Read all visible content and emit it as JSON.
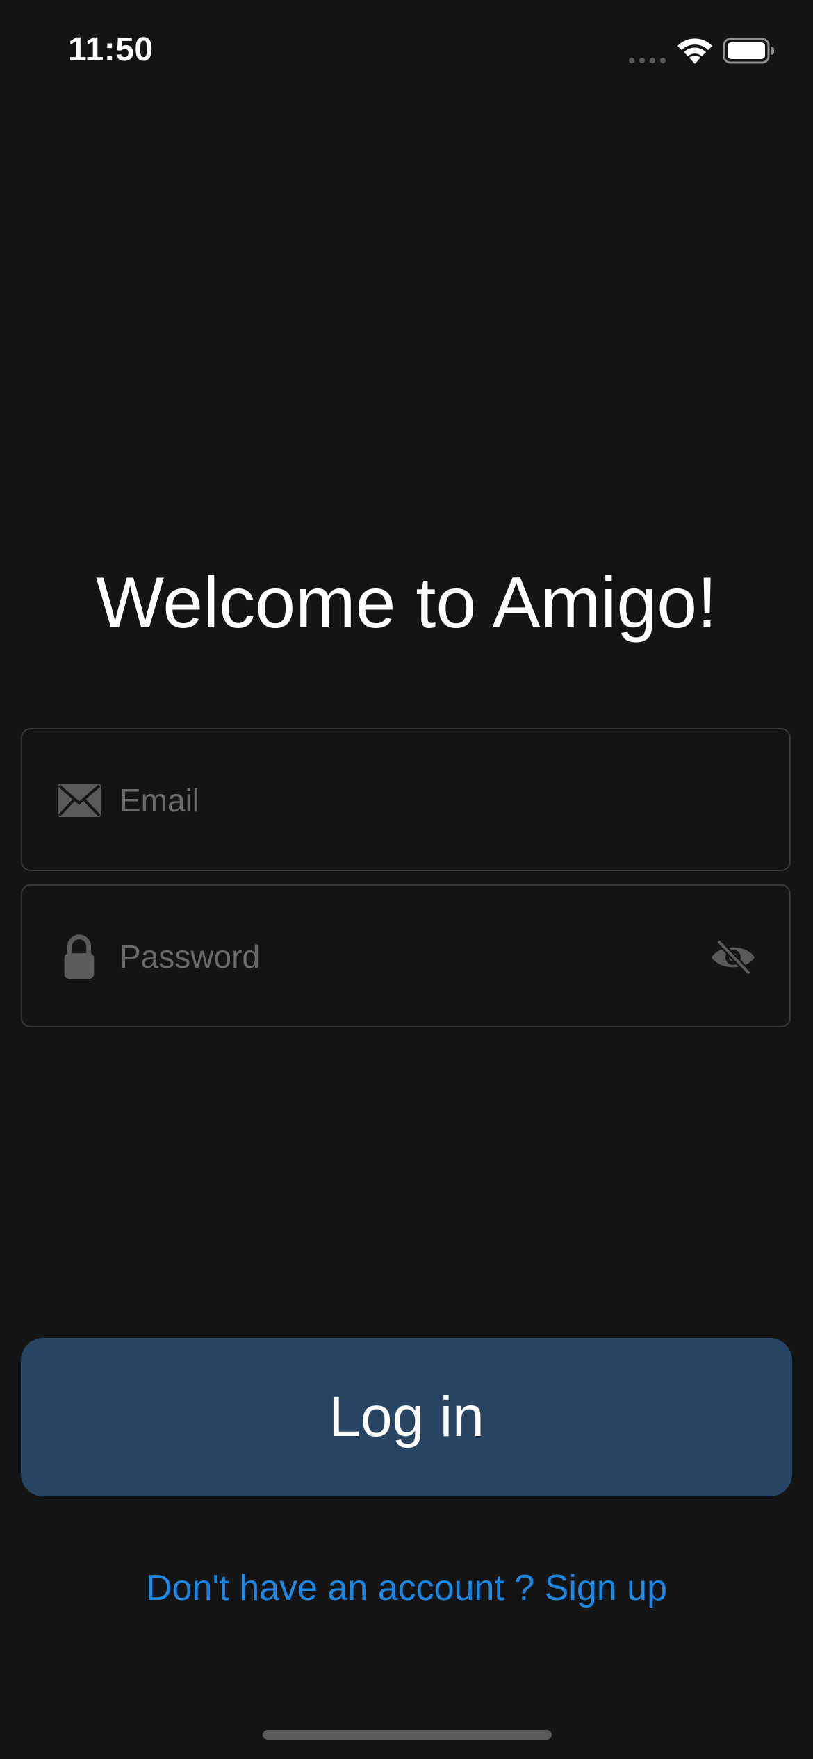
{
  "status_bar": {
    "time": "11:50",
    "icons": [
      "cellular-signal-icon",
      "wifi-icon",
      "battery-icon"
    ]
  },
  "title": "Welcome to Amigo!",
  "email_field": {
    "icon": "envelope-icon",
    "placeholder": "Email",
    "value": ""
  },
  "password_field": {
    "icon": "lock-icon",
    "placeholder": "Password",
    "value": "",
    "toggle_icon": "eye-slash-icon"
  },
  "login_button": {
    "label": "Log in"
  },
  "signup_link": {
    "label": "Don't have an account ? Sign up"
  },
  "colors": {
    "background": "#141414",
    "button": "#274563",
    "link": "#1e88e5",
    "placeholder": "#6a6a6e",
    "field_border": "#3a3a3c"
  }
}
